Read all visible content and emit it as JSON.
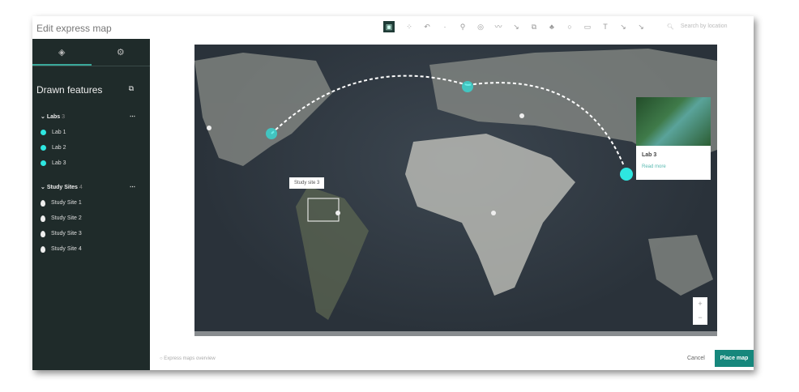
{
  "title": "Edit express map",
  "toolbar": {
    "search_placeholder": "Search by location",
    "tools": [
      "select",
      "pan",
      "undo",
      "redo",
      "pin",
      "circle-marker",
      "line",
      "arrow",
      "frame",
      "stamp",
      "circle",
      "rectangle",
      "text",
      "line-tool",
      "arrow-tool"
    ]
  },
  "sidebar": {
    "heading": "Drawn features",
    "groups": [
      {
        "name": "Labs",
        "count": "3",
        "items": [
          "Lab 1",
          "Lab 2",
          "Lab 3"
        ]
      },
      {
        "name": "Study Sites",
        "count": "4",
        "items": [
          "Study Site 1",
          "Study Site 2",
          "Study Site 3",
          "Study Site 4"
        ]
      }
    ]
  },
  "map": {
    "popup": {
      "title": "Lab 3",
      "link": "Read more"
    },
    "label": "Study site 3",
    "zoom_in": "+",
    "zoom_out": "−"
  },
  "footer": {
    "overview_link": "Express maps overview",
    "cancel": "Cancel",
    "place": "Place map"
  },
  "colors": {
    "accent": "#16877c",
    "lab": "#2ee6e0",
    "sidebar": "#1f2b2a"
  }
}
